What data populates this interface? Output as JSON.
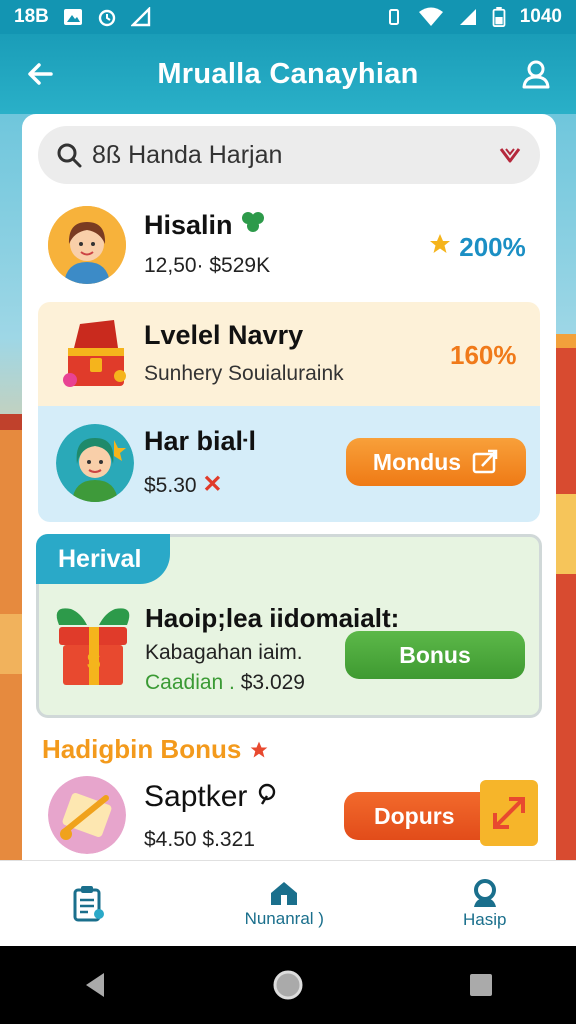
{
  "status": {
    "time_left": "18B",
    "time_right": "1040"
  },
  "appbar": {
    "title": "Mrualla Canayhian"
  },
  "search": {
    "value": "8ß Handa Harjan"
  },
  "rows": [
    {
      "name": "Hisalin",
      "sub": "12,50· $529K",
      "value": "200%",
      "value_color": "#1b8fc4"
    },
    {
      "name": "Lvelel Navry",
      "sub": "Sunhery Souialuraink",
      "value": "160%",
      "value_color": "#f07a1a"
    },
    {
      "name": "Har biaŀl",
      "sub": "$5.30",
      "button": "Mondus"
    }
  ],
  "featured": {
    "tag": "Herival",
    "title": "Haoip;lea iidomaialt:",
    "sub1": "Kabagahan iaim.",
    "sub2_label": "Caadian .",
    "sub2_value": "$3.029",
    "button": "Bonus"
  },
  "section": {
    "heading": "Hadigbin Bonus"
  },
  "last_row": {
    "name": "Saptker",
    "sub": "$4.50 $.321",
    "button": "Dopurs"
  },
  "bottom_nav": [
    {
      "label": "",
      "icon": "clipboard-icon"
    },
    {
      "label": "Nunanral )",
      "icon": "home-icon"
    },
    {
      "label": "Hasip",
      "icon": "profile-search-icon"
    }
  ],
  "colors": {
    "primary": "#1ea6c0",
    "orange_button": "#f2811d",
    "green_button": "#4aa637"
  }
}
